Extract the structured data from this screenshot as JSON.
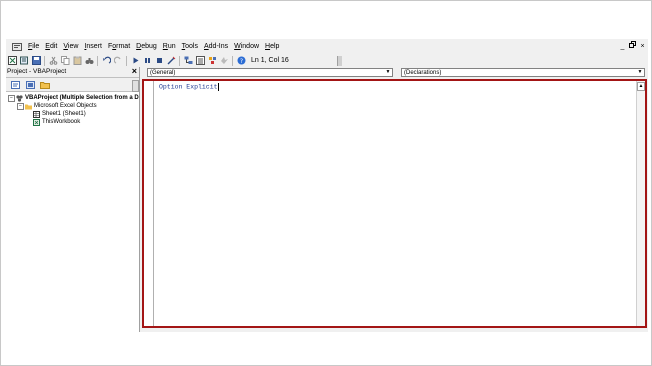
{
  "menu": {
    "items": [
      {
        "u": "F",
        "rest": "ile"
      },
      {
        "u": "E",
        "rest": "dit"
      },
      {
        "u": "V",
        "rest": "iew"
      },
      {
        "u": "I",
        "rest": "nsert"
      },
      {
        "u": "",
        "pre": "F",
        "u2": "o",
        "rest": "rmat"
      },
      {
        "u": "D",
        "rest": "ebug"
      },
      {
        "u": "R",
        "rest": "un"
      },
      {
        "u": "T",
        "rest": "ools"
      },
      {
        "u": "A",
        "rest": "dd-Ins"
      },
      {
        "u": "W",
        "rest": "indow"
      },
      {
        "u": "H",
        "rest": "elp"
      }
    ],
    "window_controls": [
      "_",
      "ə",
      "×"
    ]
  },
  "toolbar": {
    "status": "Ln 1, Col 16"
  },
  "project": {
    "title": "Project - VBAProject",
    "close": "×",
    "root": "VBAProject (Multiple Selection from a D",
    "folder": "Microsoft Excel Objects",
    "sheet": "Sheet1 (Sheet1)",
    "workbook": "ThisWorkbook"
  },
  "code": {
    "object_combo": "(General)",
    "proc_combo": "(Declarations)",
    "line1": "Option Explicit"
  },
  "colors": {
    "highlight_border": "#a31515",
    "code_blue": "#1f3a93"
  }
}
